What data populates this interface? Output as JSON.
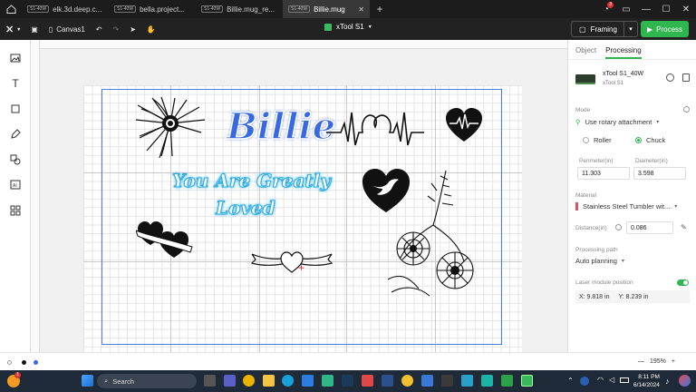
{
  "tabs": [
    {
      "badge": "S1-40W",
      "title": "elk.3d.deep.c...",
      "active": false
    },
    {
      "badge": "S1-40W",
      "title": "bella.project...",
      "active": false
    },
    {
      "badge": "S1-40W",
      "title": "Billie.mug_re...",
      "active": false
    },
    {
      "badge": "S1-40W",
      "title": "Billie.mug",
      "active": true
    }
  ],
  "window": {
    "notification_count": "3"
  },
  "toolbar": {
    "canvas_name": "Canvas1",
    "device_name": "xTool S1",
    "framing_label": "Framing",
    "process_label": "Process"
  },
  "canvas": {
    "billie_text": "Billie",
    "you_are_text": "You Are Greatly",
    "loved_text": "Loved"
  },
  "panel": {
    "tab_object": "Object",
    "tab_processing": "Processing",
    "device_model": "xTool S1_40W",
    "device_sub": "xTool S1",
    "mode_label": "Mode",
    "mode_value": "Use rotary attachment",
    "roller_label": "Roller",
    "chuck_label": "Chuck",
    "selected_rotary": "Chuck",
    "perimeter_label": "Perimeter(in)",
    "perimeter_value": "11.303",
    "diameter_label": "Diameter(in)",
    "diameter_value": "3.598",
    "material_label": "Material",
    "material_value": "Stainless Steel Tumbler wit...",
    "distance_label": "Distance(in)",
    "distance_value": "0.086",
    "path_label": "Processing path",
    "path_value": "Auto planning",
    "laser_pos_label": "Laser module position",
    "laser_pos_enabled": true,
    "x_label": "X: 9.818 in",
    "y_label": "Y: 8.239 in"
  },
  "statusbar": {
    "zoom": "195%"
  },
  "taskbar": {
    "weather_badge": "1",
    "search_placeholder": "Search",
    "time": "8:11 PM",
    "date": "6/14/2024"
  }
}
